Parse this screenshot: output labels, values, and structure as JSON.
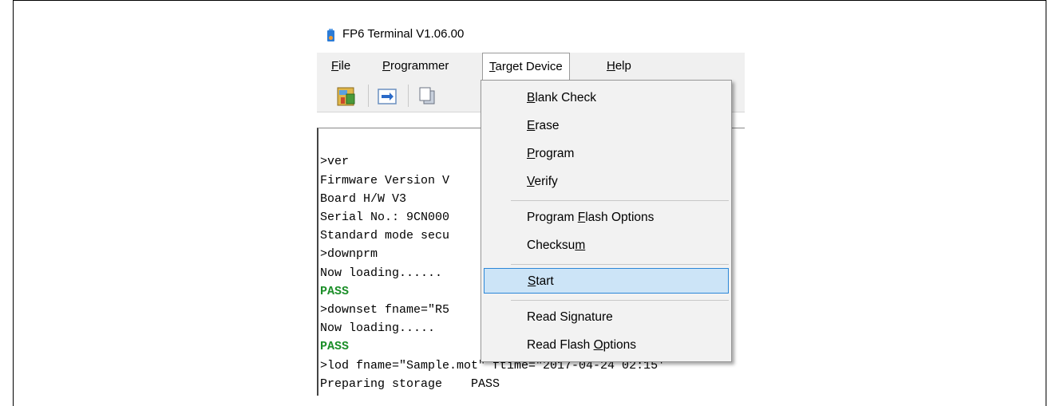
{
  "window": {
    "title": "FP6 Terminal V1.06.00"
  },
  "menubar": {
    "items": [
      {
        "pre": "",
        "acc": "F",
        "post": "ile"
      },
      {
        "pre": "",
        "acc": "P",
        "post": "rogrammer"
      },
      {
        "pre": "",
        "acc": "T",
        "post": "arget Device"
      },
      {
        "pre": "",
        "acc": "H",
        "post": "elp"
      }
    ]
  },
  "toolbar": {
    "icons": [
      "device-config-icon",
      "connect-icon",
      "copy-icon"
    ]
  },
  "terminal": {
    "lines": [
      ">ver",
      "Firmware Version V",
      "Board H/W V3",
      "Serial No.: 9CN000",
      "Standard mode secu",
      ">downprm",
      "Now loading......",
      "PASS",
      ">downset fname=\"R5",
      "Now loading.....",
      "PASS",
      ">lod fname=\"Sample.mot\" ftime=\"2017-04-24 02:15'",
      "Preparing storage    PASS"
    ],
    "pass_color": "#1d8f2a"
  },
  "dropdown": {
    "items": [
      {
        "pre": "",
        "acc": "B",
        "post": "lank Check"
      },
      {
        "pre": "",
        "acc": "E",
        "post": "rase"
      },
      {
        "pre": "",
        "acc": "P",
        "post": "rogram"
      },
      {
        "pre": "",
        "acc": "V",
        "post": "erify"
      },
      {
        "pre": "Program ",
        "acc": "F",
        "post": "lash Options"
      },
      {
        "pre": "Checksu",
        "acc": "m",
        "post": ""
      },
      {
        "pre": "",
        "acc": "S",
        "post": "tart"
      },
      {
        "pre": "Read Si",
        "acc": "g",
        "post": "nature"
      },
      {
        "pre": "Read Flash ",
        "acc": "O",
        "post": "ptions"
      }
    ],
    "highlighted_index": 6,
    "highlight_color": "#cce4f7"
  }
}
